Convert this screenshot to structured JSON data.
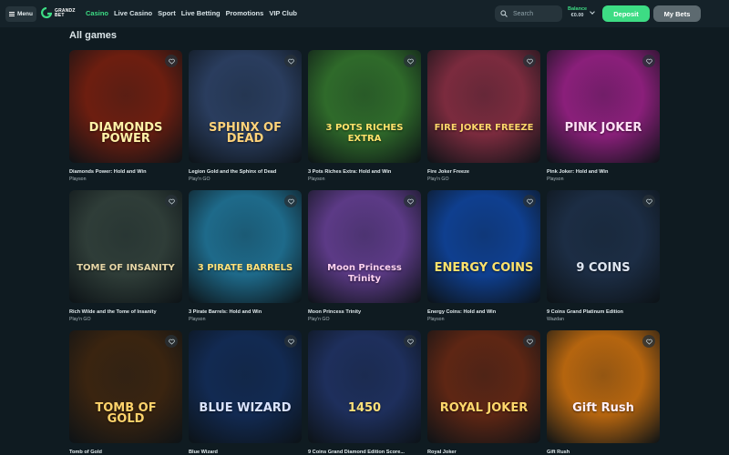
{
  "header": {
    "menu_label": "Menu",
    "brand_line1": "GRANDZ",
    "brand_line2": "BET",
    "nav": [
      "Casino",
      "Live Casino",
      "Sport",
      "Live Betting",
      "Promotions",
      "VIP Club"
    ],
    "active_nav": "Casino",
    "search_placeholder": "Search",
    "balance_label": "Balance",
    "balance_value": "€0.00",
    "deposit_label": "Deposit",
    "mybets_label": "My Bets"
  },
  "section_title": "All games",
  "games": [
    {
      "name": "Diamonds Power: Hold and Win",
      "provider": "Playson",
      "art": "DIAMONDS POWER",
      "bg": "#6d1e10"
    },
    {
      "name": "Legion Gold and the Sphinx of Dead",
      "provider": "Play'n GO",
      "art": "SPHINX OF DEAD",
      "bg": "#2a3d5e"
    },
    {
      "name": "3 Pots Riches Extra: Hold and Win",
      "provider": "Playson",
      "art": "3 POTS RICHES EXTRA",
      "bg": "#2f6a2a"
    },
    {
      "name": "Fire Joker Freeze",
      "provider": "Play'n GO",
      "art": "FIRE JOKER FREEZE",
      "bg": "#7b2b3e"
    },
    {
      "name": "Pink Joker: Hold and Win",
      "provider": "Playson",
      "art": "PINK JOKER",
      "bg": "#8a1f7a"
    },
    {
      "name": "Rich Wilde and the Tome of Insanity",
      "provider": "Play'n GO",
      "art": "TOME OF INSANITY",
      "bg": "#2f3d38"
    },
    {
      "name": "3 Pirate Barrels: Hold and Win",
      "provider": "Playson",
      "art": "3 PIRATE BARRELS",
      "bg": "#1e6a8a"
    },
    {
      "name": "Moon Princess Trinity",
      "provider": "Play'n GO",
      "art": "Moon Princess Trinity",
      "bg": "#5c3a86"
    },
    {
      "name": "Energy Coins: Hold and Win",
      "provider": "Playson",
      "art": "ENERGY COINS",
      "bg": "#0f3f8f"
    },
    {
      "name": "9 Coins Grand Platinum Edition",
      "provider": "Wazdan",
      "art": "9 COINS",
      "bg": "#1c2d44"
    },
    {
      "name": "Tomb of Gold",
      "provider": "",
      "art": "TOMB OF GOLD",
      "bg": "#3a2410"
    },
    {
      "name": "Blue Wizard",
      "provider": "",
      "art": "BLUE WIZARD",
      "bg": "#122a52"
    },
    {
      "name": "9 Coins Grand Diamond Edition Score...",
      "provider": "",
      "art": "1450",
      "bg": "#1e2f5c"
    },
    {
      "name": "Royal Joker",
      "provider": "",
      "art": "ROYAL JOKER",
      "bg": "#5e2614"
    },
    {
      "name": "Gift Rush",
      "provider": "",
      "art": "Gift Rush",
      "bg": "#b5650f"
    }
  ]
}
